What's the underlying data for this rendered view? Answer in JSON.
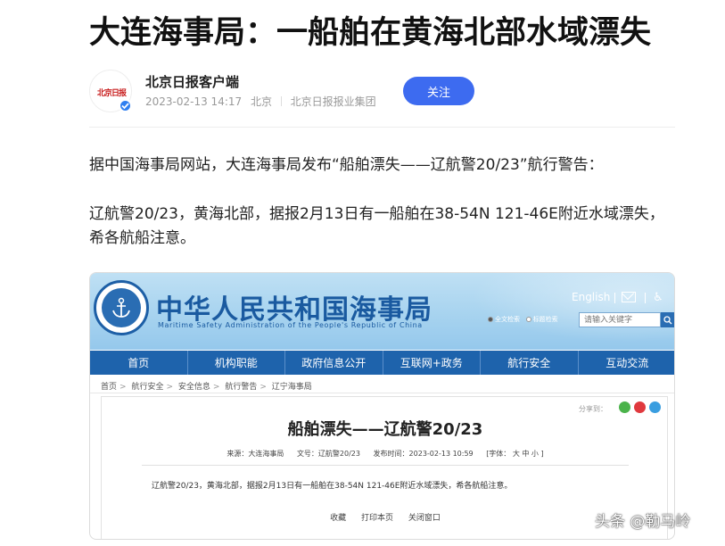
{
  "article": {
    "title": "大连海事局：一船舶在黄海北部水域漂失",
    "author": {
      "name": "北京日报客户端",
      "avatar_text": "北京日报",
      "date": "2023-02-13 14:17",
      "location": "北京",
      "organization": "北京日报报业集团",
      "follow_label": "关注"
    },
    "paragraphs": [
      "据中国海事局网站，大连海事局发布“船舶漂失——辽航警20/23”航行警告：",
      "辽航警20/23，黄海北部，据报2月13日有一船舶在38-54N 121-46E附近水域漂失，希各航船注意。"
    ]
  },
  "screenshot": {
    "site_title_cn": "中华人民共和国海事局",
    "site_title_en": "Maritime Safety Administration of the People's Republic of China",
    "emblem_text": "CHINA MSA",
    "english_link": "English",
    "search": {
      "option_1": "全文检索",
      "option_2": "标题检索",
      "placeholder": "请输入关键字"
    },
    "nav": [
      "首页",
      "机构职能",
      "政府信息公开",
      "互联网+政务",
      "航行安全",
      "互动交流"
    ],
    "breadcrumb": [
      "首页",
      "航行安全",
      "安全信息",
      "航行警告",
      "辽宁海事局"
    ],
    "share_label": "分享到：",
    "doc": {
      "title": "船舶漂失——辽航警20/23",
      "source": "来源：大连海事局",
      "doc_no": "文号：辽航警20/23",
      "publish_time": "发布时间：2023-02-13 10:59",
      "font_size": "[字体： 大  中  小 ]",
      "body": "辽航警20/23，黄海北部，据报2月13日有一船舶在38-54N 121-46E附近水域漂失，希各航船注意。",
      "actions": [
        "收藏",
        "打印本页",
        "关闭窗口"
      ]
    }
  },
  "watermark": "头条 @勒马岭",
  "colors": {
    "follow_button": "#3d6bf0",
    "nav_bar": "#1e63ac",
    "site_title": "#1a5aa0",
    "verified_badge": "#2f7ff0"
  }
}
